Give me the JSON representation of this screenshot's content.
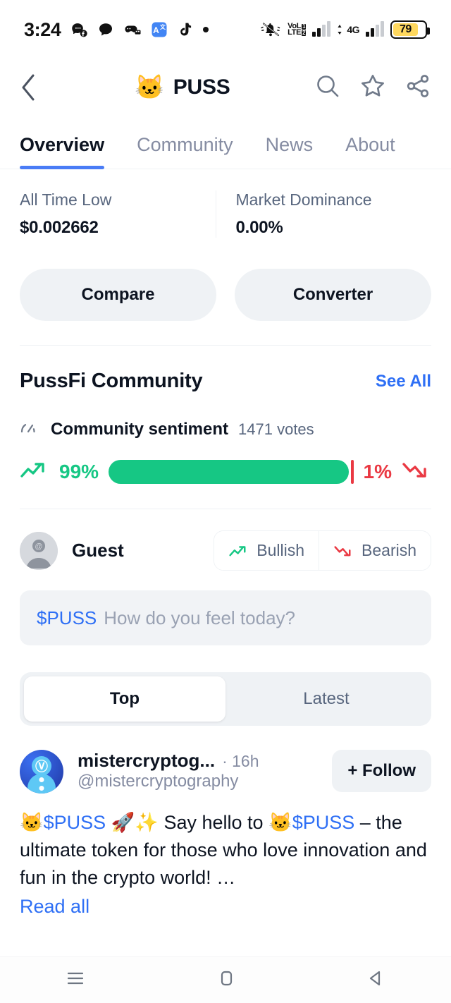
{
  "status_bar": {
    "time": "3:24",
    "left_icons": [
      "messenger-icon",
      "chat-bubble-icon",
      "game-controller-icon",
      "translate-icon",
      "tiktok-icon",
      "dot-icon"
    ],
    "right": {
      "mute_icon": "bell-muted-icon",
      "volte_top": "VoL",
      "volte_bottom": "LTE",
      "sim1_badge": "1",
      "sim2_badge": "2",
      "network": "4G",
      "battery_percent": "79"
    }
  },
  "appbar": {
    "back_icon": "chevron-left-icon",
    "coin_emoji": "🐱",
    "coin_name": "PUSS",
    "search_icon": "search-icon",
    "star_icon": "star-icon",
    "share_icon": "share-icon"
  },
  "tabs": [
    {
      "label": "Overview",
      "active": true
    },
    {
      "label": "Community",
      "active": false
    },
    {
      "label": "News",
      "active": false
    },
    {
      "label": "About",
      "active": false
    }
  ],
  "stats": [
    {
      "label": "All Time Low",
      "value": "$0.002662"
    },
    {
      "label": "Market Dominance",
      "value": "0.00%"
    }
  ],
  "action_buttons": [
    {
      "label": "Compare"
    },
    {
      "label": "Converter"
    }
  ],
  "community": {
    "title": "PussFi Community",
    "see_all": "See All",
    "sentiment": {
      "icon": "gauge-icon",
      "title": "Community sentiment",
      "votes": "1471 votes",
      "bullish_pct_label": "99%",
      "bearish_pct_label": "1%",
      "bullish_value": 99,
      "bearish_value": 1,
      "bullish_color": "#16c784",
      "bearish_color": "#ea3943",
      "up_icon": "trend-up-icon",
      "down_icon": "trend-down-icon"
    },
    "guest": {
      "avatar_icon": "guest-avatar-icon",
      "name": "Guest",
      "bullish_label": "Bullish",
      "bearish_label": "Bearish"
    },
    "composer": {
      "ticker": "$PUSS",
      "placeholder": "How do you feel today?"
    },
    "feed_tabs": [
      {
        "label": "Top",
        "active": true
      },
      {
        "label": "Latest",
        "active": false
      }
    ],
    "posts": [
      {
        "avatar_icon": "coinmarketcap-avatar-icon",
        "display_name": "mistercryptog...",
        "time": "· 16h",
        "handle": "@mistercryptography",
        "follow_label": "+ Follow",
        "body_prefix_emoji": "🐱",
        "body_ticker1": "$PUSS",
        "body_mid_emoji": "🚀✨",
        "body_text1": "Say hello to",
        "body_ticker2": "$PUSS",
        "body_text2": "– the ultimate token for those who love innovation and fun in the crypto world! …",
        "read_all": "Read all"
      }
    ]
  },
  "navbar": {
    "menu_icon": "hamburger-icon",
    "home_icon": "home-square-icon",
    "back_icon": "back-triangle-icon"
  },
  "colors": {
    "accent": "#2e6ff5",
    "tab_indicator": "#4a7cf6",
    "bullish": "#16c784",
    "bearish": "#ea3943",
    "muted": "#58667e",
    "surface": "#eff2f5"
  }
}
